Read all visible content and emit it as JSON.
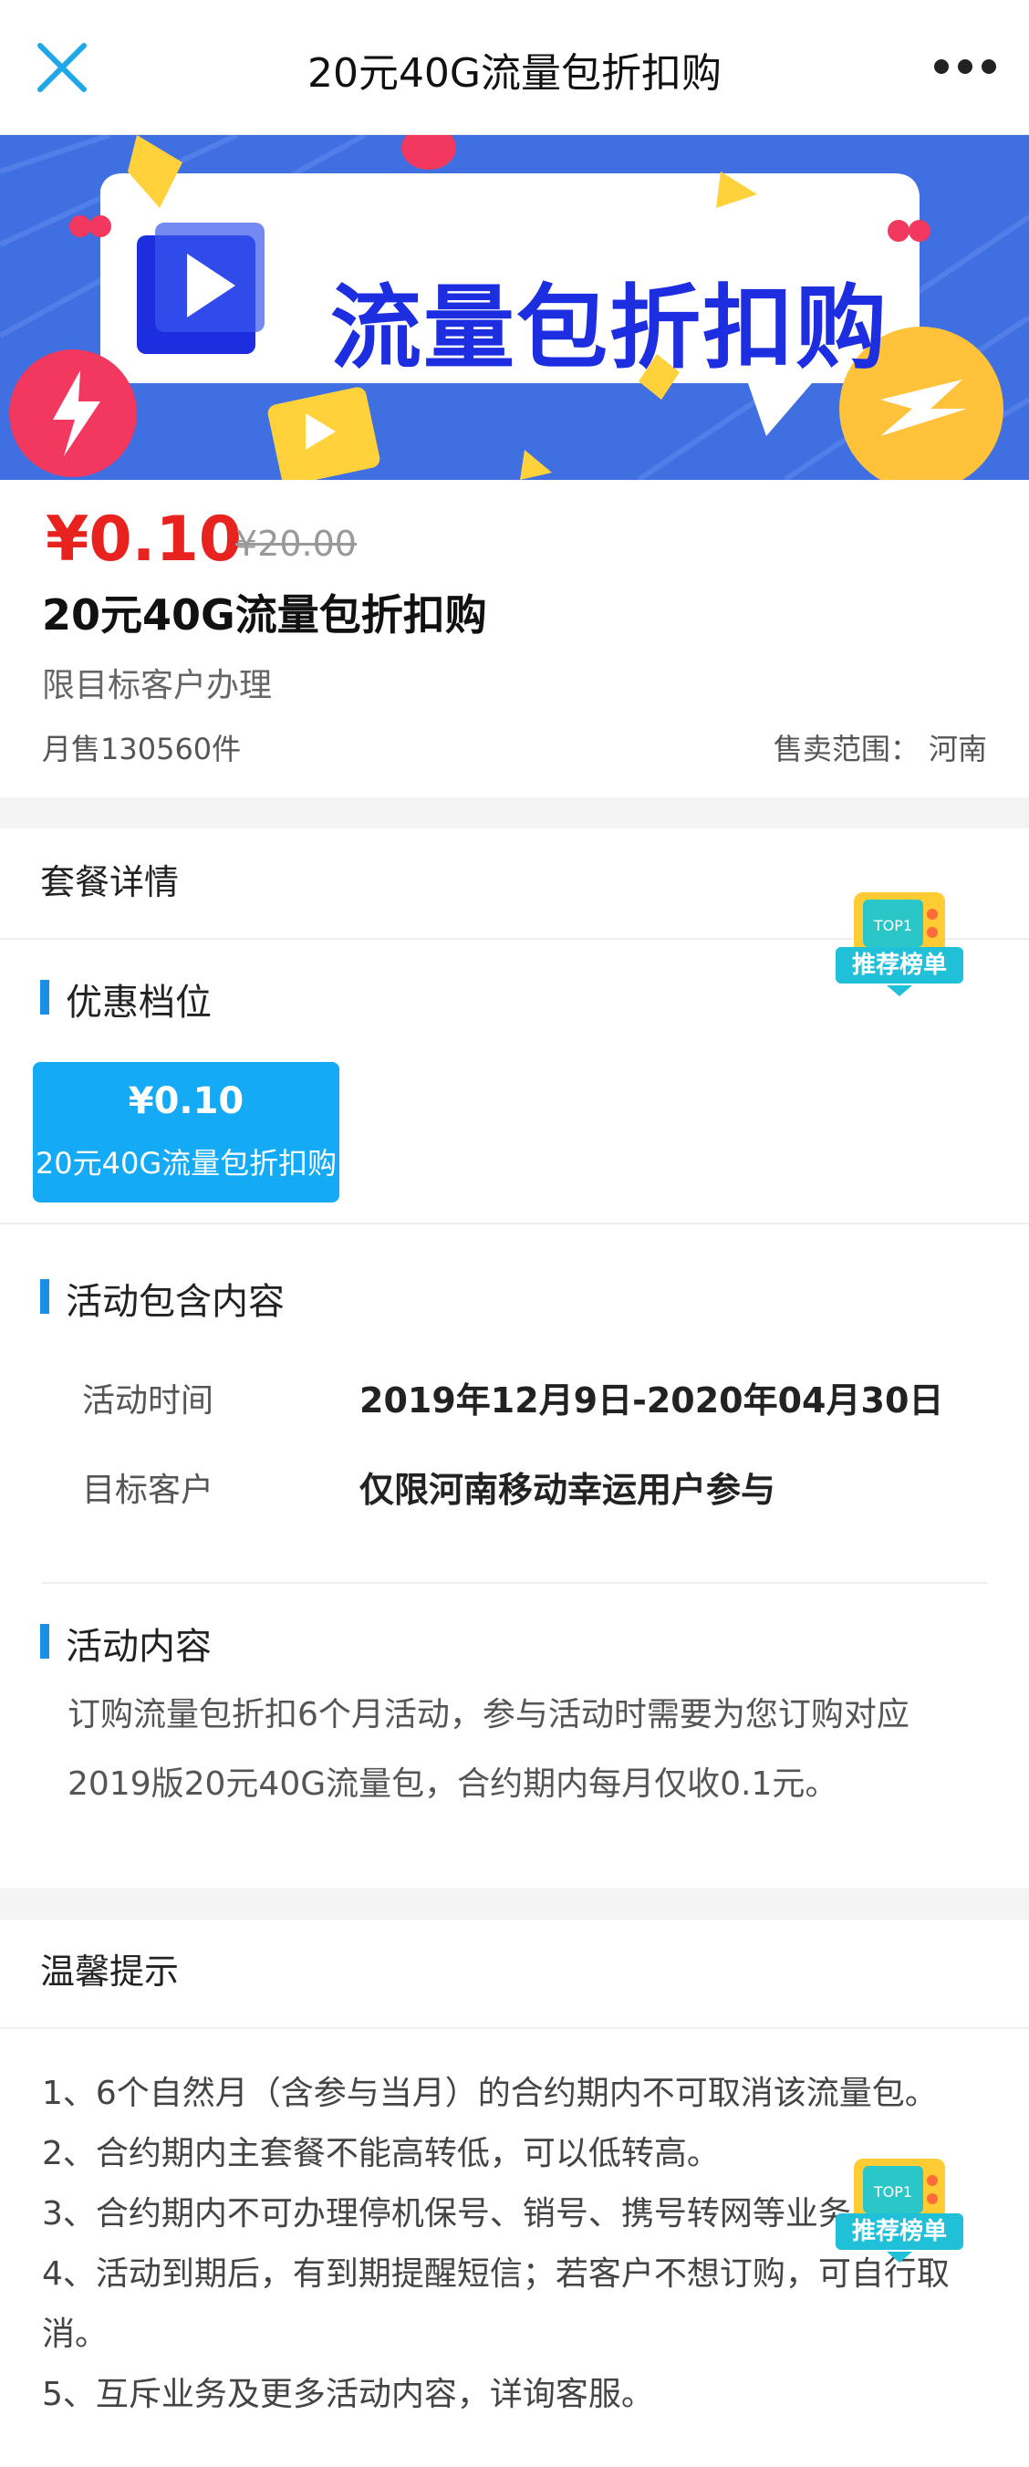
{
  "header": {
    "title": "20元40G流量包折扣购",
    "close_icon": "close-icon",
    "more_icon": "more-icon"
  },
  "banner": {
    "text": "流量包折扣购",
    "colors": {
      "background": "#3f6fe0",
      "text": "#1d2ee0"
    }
  },
  "product": {
    "price": "¥0.10",
    "original_price": "¥20.00",
    "title": "20元40G流量包折扣购",
    "subtitle": "限目标客户办理",
    "sold": "月售130560件",
    "scope": "售卖范围： 河南"
  },
  "details": {
    "section_title": "套餐详情",
    "tier_heading": "优惠档位",
    "tier": {
      "price": "¥0.10",
      "name": "20元40G流量包折扣购"
    },
    "activity_heading": "活动包含内容",
    "rows": [
      {
        "label": "活动时间",
        "value": "2019年12月9日-2020年04月30日"
      },
      {
        "label": "目标客户",
        "value": "仅限河南移动幸运用户参与"
      }
    ],
    "content_heading": "活动内容",
    "content_text": "订购流量包折扣6个月活动，参与活动时需要为您订购对应2019版20元40G流量包，合约期内每月仅收0.1元。"
  },
  "tips": {
    "section_title": "温馨提示",
    "items": [
      "1、6个自然月（含参与当月）的合约期内不可取消该流量包。",
      "2、合约期内主套餐不能高转低，可以低转高。",
      "3、合约期内不可办理停机保号、销号、携号转网等业务。",
      "4、活动到期后，有到期提醒短信；若客户不想订购，可自行取消。",
      "5、互斥业务及更多活动内容，详询客服。"
    ]
  },
  "badge": {
    "label": "推荐榜单",
    "top_text": "TOP1"
  },
  "colors": {
    "price_red": "#e8231f",
    "accent_blue": "#1a8fe8",
    "tier_card": "#14aaf5"
  }
}
